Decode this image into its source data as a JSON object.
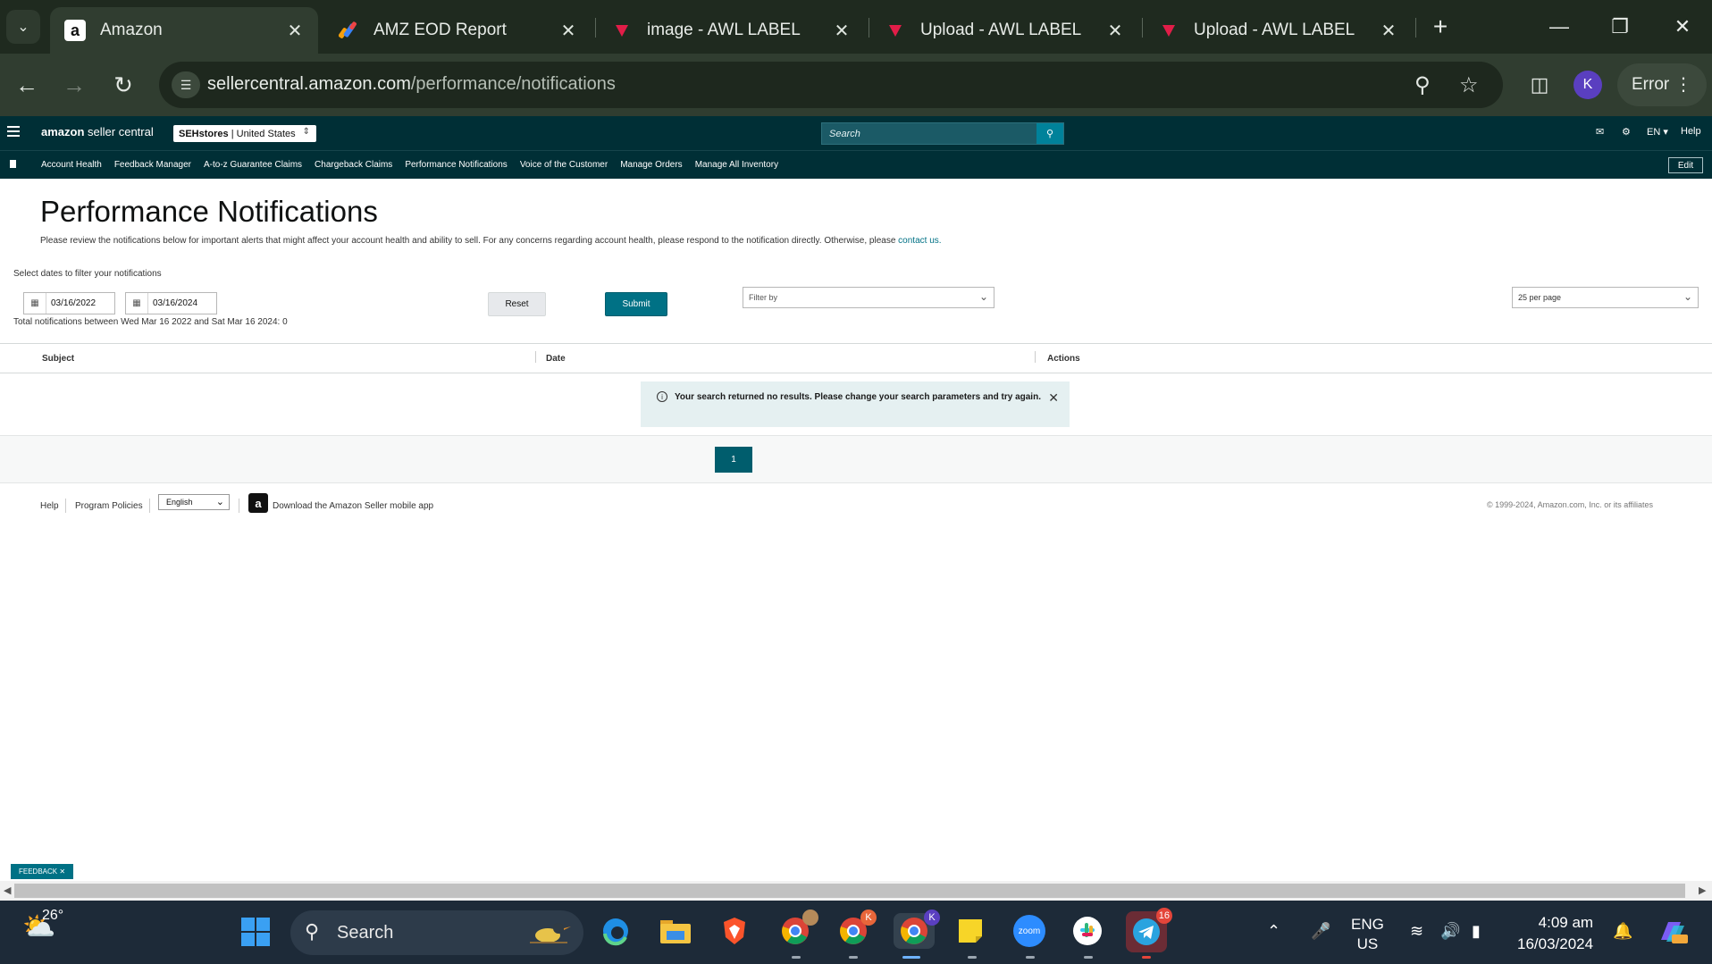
{
  "browser": {
    "tabs": [
      {
        "title": "Amazon",
        "icon": "amazon-icon"
      },
      {
        "title": "AMZ EOD Report",
        "icon": "report-icon"
      },
      {
        "title": "image - AWL LABEL",
        "icon": "awl-icon"
      },
      {
        "title": "Upload - AWL LABEL",
        "icon": "awl-icon"
      },
      {
        "title": "Upload - AWL LABEL",
        "icon": "awl-icon"
      }
    ],
    "url_host": "sellercentral.amazon.com",
    "url_path": "/performance/notifications",
    "profile_initial": "K",
    "error_label": "Error"
  },
  "header": {
    "logo_brand": "amazon",
    "logo_suffix": "seller central",
    "store": "SEHstores",
    "marketplace": "United States",
    "search_placeholder": "Search",
    "language": "EN",
    "help": "Help"
  },
  "nav": {
    "items": [
      "Account Health",
      "Feedback Manager",
      "A-to-z Guarantee Claims",
      "Chargeback Claims",
      "Performance Notifications",
      "Voice of the Customer",
      "Manage Orders",
      "Manage All Inventory"
    ],
    "edit": "Edit"
  },
  "page": {
    "title": "Performance Notifications",
    "intro": "Please review the notifications below for important alerts that might affect your account health and ability to sell. For any concerns regarding account health, please respond to the notification directly. Otherwise, please",
    "contact_link": "contact us.",
    "dates_label": "Select dates to filter your notifications",
    "date_from": "03/16/2022",
    "date_to": "03/16/2024",
    "total_text": "Total notifications between Wed Mar 16 2022 and Sat Mar 16 2024: 0",
    "reset": "Reset",
    "submit": "Submit",
    "filter_placeholder": "Filter by",
    "per_page": "25 per page"
  },
  "table": {
    "columns": [
      "Subject",
      "Date",
      "Actions"
    ]
  },
  "alert": {
    "message": "Your search returned no results. Please change your search parameters and try again."
  },
  "pagination": {
    "current_page": "1"
  },
  "footer": {
    "help": "Help",
    "policies": "Program Policies",
    "language": "English",
    "app_text": "Download the Amazon Seller mobile app",
    "copyright": "© 1999-2024, Amazon.com, Inc. or its affiliates"
  },
  "feedback": "FEEDBACK",
  "taskbar": {
    "temperature": "26°",
    "search_placeholder": "Search",
    "telegram_badge": "16",
    "chrome_badge_1": "K",
    "chrome_badge_2": "K",
    "zoom_label": "zoom",
    "lang_line1": "ENG",
    "lang_line2": "US",
    "time": "4:09 am",
    "date": "16/03/2024"
  },
  "colors": {
    "seller_header": "#002f36",
    "accent_teal": "#007185",
    "chrome_dark": "#1f2a1f",
    "taskbar": "#1d2a38"
  }
}
